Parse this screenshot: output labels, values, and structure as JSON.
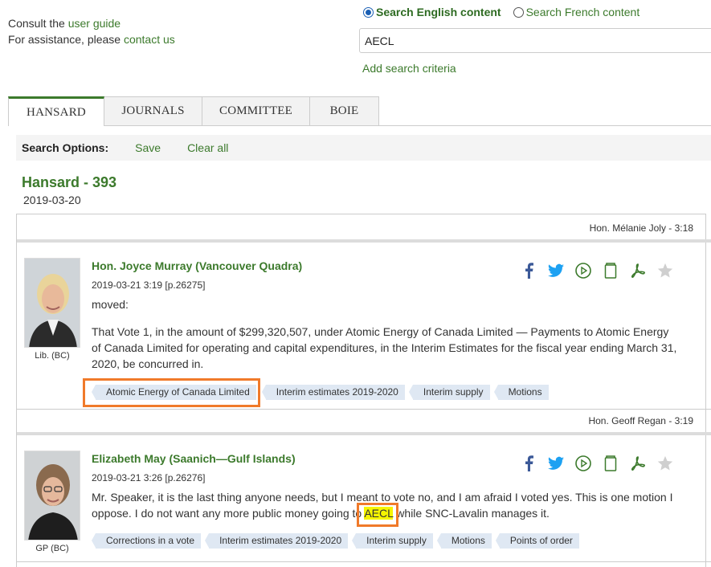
{
  "help": {
    "consult_prefix": "Consult the ",
    "user_guide": "user guide",
    "assist_prefix": "For assistance, please ",
    "contact_us": "contact us"
  },
  "search": {
    "lang_en": "Search English content",
    "lang_fr": "Search French content",
    "selected_lang": "en",
    "query": "AECL",
    "add_criteria": "Add search criteria"
  },
  "tabs": [
    {
      "label": "HANSARD",
      "active": true
    },
    {
      "label": "JOURNALS",
      "active": false
    },
    {
      "label": "COMMITTEE",
      "active": false
    },
    {
      "label": "BOIE",
      "active": false
    }
  ],
  "options": {
    "label": "Search Options:",
    "save": "Save",
    "clear": "Clear all"
  },
  "hansard": {
    "title": "Hansard - 393",
    "date": "2019-03-20"
  },
  "results": [
    {
      "prev_speaker": "Hon. Mélanie Joly - 3:18",
      "name": "Hon. Joyce Murray (Vancouver Quadra)",
      "meta": "2019-03-21 3:19 [p.26275]",
      "party": "Lib. (BC)",
      "moved": "moved:",
      "text": "That Vote 1, in the amount of $299,320,507, under Atomic Energy of Canada Limited — Payments to Atomic Energy of Canada Limited for operating and capital expenditures, in the Interim Estimates for the fiscal year ending March 31, 2020, be concurred in.",
      "tags": [
        "Atomic Energy of Canada Limited",
        "Interim estimates 2019-2020",
        "Interim supply",
        "Motions"
      ]
    },
    {
      "prev_speaker": "Hon. Geoff Regan - 3:19",
      "name": "Elizabeth May (Saanich—Gulf Islands)",
      "meta": "2019-03-21 3:26 [p.26276]",
      "party": "GP (BC)",
      "text_before": "Mr. Speaker, it is the last thing anyone needs, but I meant to vote no, and I am afraid I voted yes. This is one motion I oppose. I do not want any more public money going to ",
      "highlight": "AECL",
      "text_after": " while SNC-Lavalin manages it.",
      "tags": [
        "Corrections in a vote",
        "Interim estimates 2019-2020",
        "Interim supply",
        "Motions",
        "Points of order"
      ]
    }
  ],
  "icons": [
    "facebook-icon",
    "twitter-icon",
    "play-icon",
    "book-icon",
    "pdf-icon",
    "star-icon"
  ],
  "colors": {
    "brand_green": "#3c7a2c",
    "highlight_box": "#f07a2a",
    "highlight_text": "#f5f500",
    "tag_bg": "#dfe8f3",
    "facebook": "#3b5998",
    "twitter": "#1da1f2"
  }
}
